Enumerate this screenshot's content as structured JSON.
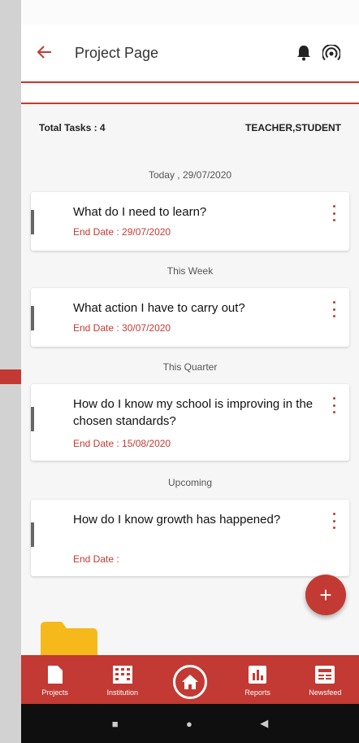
{
  "header": {
    "title": "Project Page",
    "back_icon": "arrow-left-icon",
    "icons": [
      "bell-icon",
      "broadcast-icon"
    ]
  },
  "summary": {
    "total_tasks": "Total Tasks : 4",
    "roles": "TEACHER,STUDENT"
  },
  "sections": [
    {
      "label": "Today , 29/07/2020",
      "task": {
        "title": "What do I need to learn?",
        "end_date": "End Date : 29/07/2020"
      }
    },
    {
      "label": "This Week",
      "task": {
        "title": "What action I have to carry out?",
        "end_date": "End Date : 30/07/2020"
      }
    },
    {
      "label": "This Quarter",
      "task": {
        "title": "How do I know my school is improving in the chosen standards?",
        "end_date": "End Date : 15/08/2020"
      }
    },
    {
      "label": "Upcoming",
      "task": {
        "title": "How do I know growth has happened?",
        "end_date": "End Date :"
      }
    }
  ],
  "fab": {
    "label": "+"
  },
  "bottom_nav": [
    {
      "label": "Projects",
      "icon": "document-icon"
    },
    {
      "label": "Institution",
      "icon": "building-icon"
    },
    {
      "label": "",
      "icon": "home-icon"
    },
    {
      "label": "Reports",
      "icon": "bar-chart-icon"
    },
    {
      "label": "Newsfeed",
      "icon": "newspaper-icon"
    }
  ],
  "colors": {
    "accent": "#c23a33",
    "folder": "#f6b91c",
    "nav_bar": "#0f0f0f"
  }
}
